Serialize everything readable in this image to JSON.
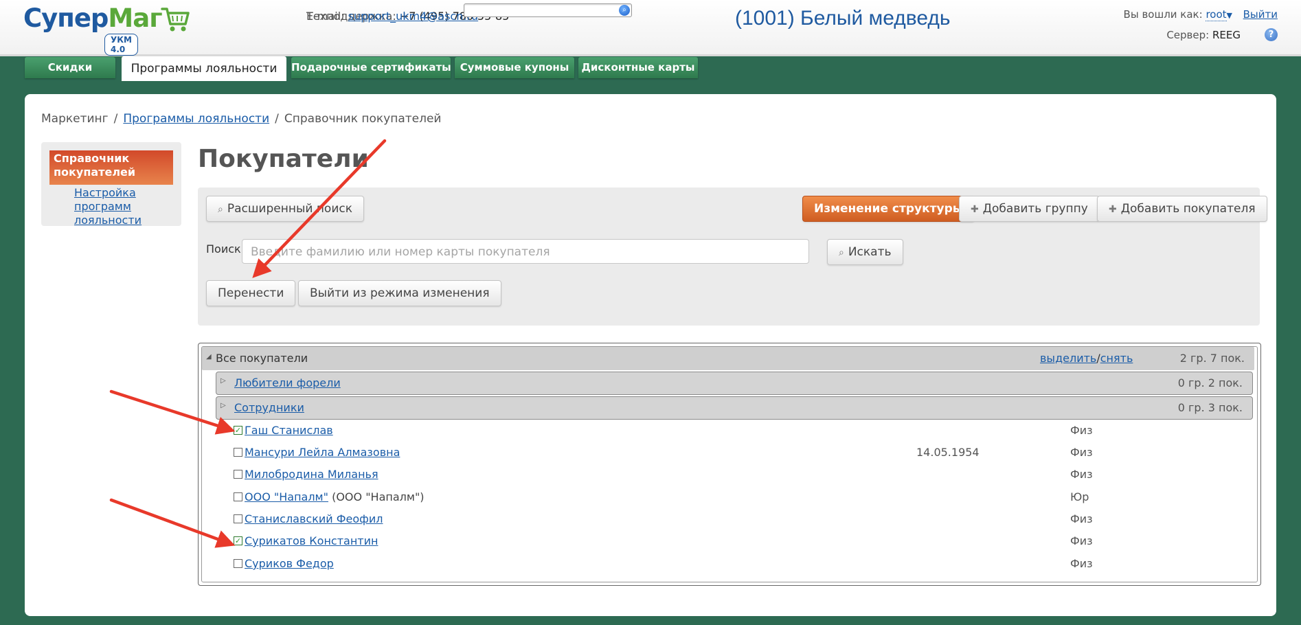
{
  "header": {
    "logo_text_blue": "Супер",
    "logo_text_green": "Маг",
    "logo_badge": "УКМ 4.0",
    "support_label": "Техподдержка:",
    "support_phone": "+7 (495) 780-55-85",
    "email_label": "E-mail:",
    "email": "support_ukm4@ascn.ru",
    "search_placeholder": "",
    "store_title": "(1001) Белый медведь",
    "logged_in_label": "Вы вошли как:",
    "user": "root",
    "logout": "Выйти",
    "server_label": "Сервер:",
    "server": "REEG"
  },
  "tabs": [
    "Скидки",
    "Программы лояльности",
    "Подарочные сертификаты",
    "Суммовые купоны",
    "Дисконтные карты"
  ],
  "breadcrumb": {
    "root": "Маркетинг",
    "sep": "/",
    "section": "Программы лояльности",
    "current": "Справочник покупателей"
  },
  "sidenav": {
    "active": "Справочник покупателей",
    "link": "Настройка программ лояльности"
  },
  "page_title": "Покупатели",
  "toolbar": {
    "advanced_search": "Расширенный поиск",
    "change_structure": "Изменение структуры",
    "add_group": "Добавить группу",
    "add_customer": "Добавить покупателя",
    "search_label": "Поиск:",
    "search_placeholder": "Введите фамилию или номер карты покупателя",
    "search_button": "Искать",
    "move_button": "Перенести",
    "exit_edit_button": "Выйти из режима изменения"
  },
  "tree": {
    "root": {
      "name": "Все покупатели",
      "select": "выделить",
      "slash": "/",
      "deselect": "снять",
      "count": "2 гр. 7 пок."
    },
    "groups": [
      {
        "name": "Любители форели",
        "count": "0 гр. 2 пок."
      },
      {
        "name": "Сотрудники",
        "count": "0 гр. 3 пок."
      }
    ],
    "customers": [
      {
        "name": "Гаш Станислав",
        "extra": "",
        "date": "",
        "type": "Физ",
        "checked": true
      },
      {
        "name": "Мансури Лейла Алмазовна",
        "extra": "",
        "date": "14.05.1954",
        "type": "Физ",
        "checked": false
      },
      {
        "name": "Милобродина Миланья",
        "extra": "",
        "date": "",
        "type": "Физ",
        "checked": false
      },
      {
        "name": "ООО \"Напалм\"",
        "extra": "(ООО \"Напалм\")",
        "date": "",
        "type": "Юр",
        "checked": false
      },
      {
        "name": "Станиславский Феофил",
        "extra": "",
        "date": "",
        "type": "Физ",
        "checked": false
      },
      {
        "name": "Сурикатов Константин",
        "extra": "",
        "date": "",
        "type": "Физ",
        "checked": true
      },
      {
        "name": "Суриков Федор",
        "extra": "",
        "date": "",
        "type": "Физ",
        "checked": false
      }
    ]
  },
  "colors": {
    "brand_blue": "#1f5aa0",
    "brand_green": "#5aa83a",
    "page_bg": "#2d6a52",
    "accent_orange": "#e07a3a",
    "annotation_red": "#e8392a"
  },
  "icons": {
    "search": "magnifier-icon",
    "add": "plus-icon",
    "cart": "cart-icon",
    "help": "help-icon"
  }
}
